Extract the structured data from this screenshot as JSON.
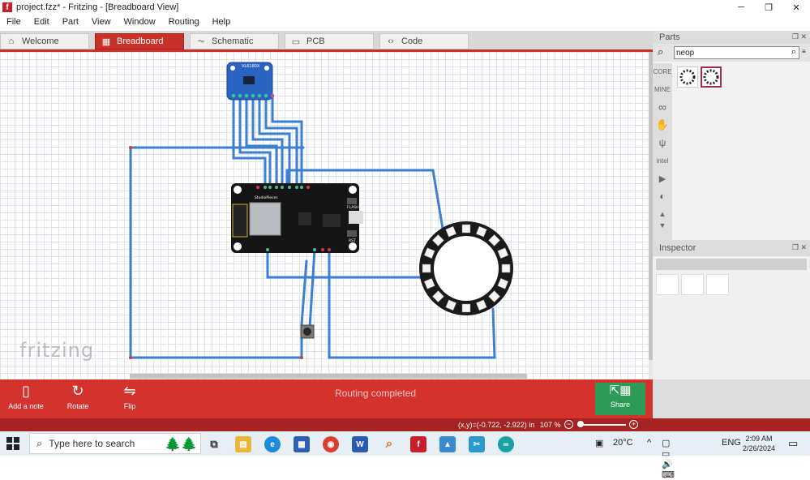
{
  "window": {
    "title": "project.fzz* - Fritzing - [Breadboard View]",
    "logo": "f",
    "minimize_icon": "─",
    "restore_icon": "❐",
    "close_icon": "✕"
  },
  "menu": [
    "File",
    "Edit",
    "Part",
    "View",
    "Window",
    "Routing",
    "Help"
  ],
  "tabs": [
    {
      "label": "Welcome",
      "icon": "⌂"
    },
    {
      "label": "Breadboard",
      "icon": "▦"
    },
    {
      "label": "Schematic",
      "icon": "⏦"
    },
    {
      "label": "PCB",
      "icon": "▭"
    },
    {
      "label": "Code",
      "icon": "‹›"
    }
  ],
  "canvas": {
    "watermark": "fritzing",
    "sensor_label": "VL6180X",
    "board_label": "StudioPieces",
    "flash_label": "FLASH",
    "rst_label": "RST"
  },
  "parts": {
    "title": "Parts",
    "search_value": "neop",
    "bins": [
      "CORE",
      "MINE"
    ]
  },
  "inspector": {
    "title": "Inspector"
  },
  "toolbar": {
    "add_note": "Add a note",
    "rotate": "Rotate",
    "flip": "Flip",
    "status": "Routing completed",
    "share": "Share"
  },
  "statusbar": {
    "coords": "(x,y)=(-0.722, -2.922) in",
    "zoom": "107 %",
    "zoom_value_percent": 107
  },
  "taskbar": {
    "search_placeholder": "Type here to search",
    "temperature": "20°C",
    "language": "ENG",
    "time": "2:09 AM",
    "date": "2/26/2024"
  },
  "colors": {
    "brand_red": "#d4322c",
    "wire_blue": "#3a7fd0",
    "share_green": "#2d9a57"
  }
}
